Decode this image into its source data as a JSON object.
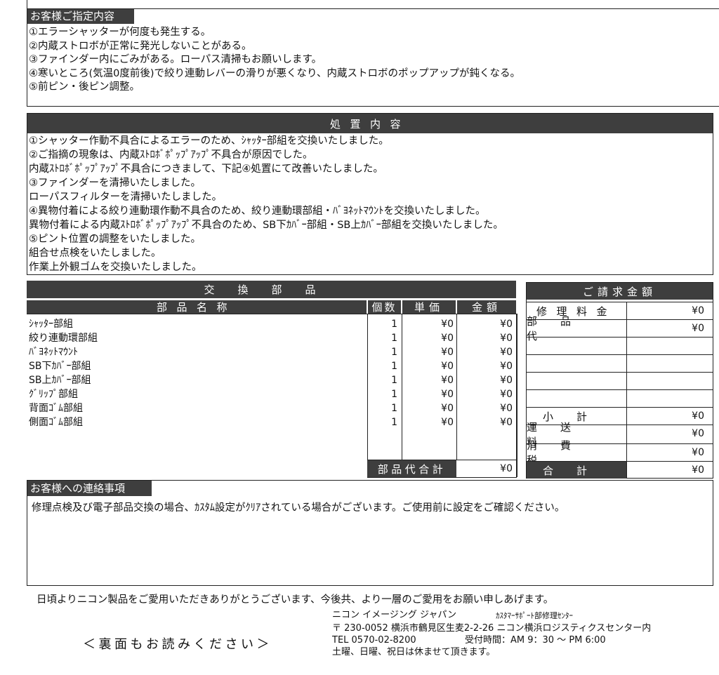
{
  "customer_request": {
    "title": "お客様ご指定内容",
    "lines": [
      "①エラーシャッターが何度も発生する。",
      "②内蔵ストロボが正常に発光しないことがある。",
      "③ファインダー内にごみがある。ローパス清掃もお願いします。",
      "④寒いところ(気温0度前後)で絞り連動レバーの滑りが悪くなり、内蔵ストロボのポップアップが鈍くなる。",
      "⑤前ピン・後ピン調整。"
    ]
  },
  "treatment": {
    "title": "処置内容",
    "lines": [
      "①シャッター作動不具合によるエラーのため、ｼｬｯﾀｰ部組を交換いたしました。",
      "②ご指摘の現象は、内蔵ｽﾄﾛﾎﾞﾎﾟｯﾌﾟｱｯﾌﾟ不具合が原因でした。",
      "内蔵ｽﾄﾛﾎﾞﾎﾟｯﾌﾟｱｯﾌﾟ不具合につきまして、下記④処置にて改善いたしました。",
      "③ファインダーを清掃いたしました。",
      "ローパスフィルターを清掃いたしました。",
      "④異物付着による絞り連動環作動不具合のため、絞り連動環部組・ﾊﾞﾖﾈｯﾄﾏｳﾝﾄを交換いたしました。",
      "異物付着による内蔵ｽﾄﾛﾎﾞﾎﾟｯﾌﾟｱｯﾌﾟ不具合のため、SB下ｶﾊﾞｰ部組・SB上ｶﾊﾞｰ部組を交換いたしました。",
      "⑤ピント位置の調整をいたしました。",
      "組合せ点検をいたしました。",
      "作業上外観ゴムを交換いたしました。"
    ]
  },
  "parts": {
    "title": "交換部品",
    "columns": [
      "部品名称",
      "個数",
      "単価",
      "金額"
    ],
    "rows": [
      {
        "name": "ｼｬｯﾀｰ部組",
        "qty": "1",
        "unit": "¥0",
        "amount": "¥0"
      },
      {
        "name": "絞り連動環部組",
        "qty": "1",
        "unit": "¥0",
        "amount": "¥0"
      },
      {
        "name": "ﾊﾞﾖﾈｯﾄﾏｳﾝﾄ",
        "qty": "1",
        "unit": "¥0",
        "amount": "¥0"
      },
      {
        "name": "SB下ｶﾊﾞｰ部組",
        "qty": "1",
        "unit": "¥0",
        "amount": "¥0"
      },
      {
        "name": "SB上ｶﾊﾞｰ部組",
        "qty": "1",
        "unit": "¥0",
        "amount": "¥0"
      },
      {
        "name": "ｸﾞﾘｯﾌﾟ部組",
        "qty": "1",
        "unit": "¥0",
        "amount": "¥0"
      },
      {
        "name": "背面ｺﾞﾑ部組",
        "qty": "1",
        "unit": "¥0",
        "amount": "¥0"
      },
      {
        "name": "側面ｺﾞﾑ部組",
        "qty": "1",
        "unit": "¥0",
        "amount": "¥0"
      }
    ],
    "total_label": "部品代合計",
    "total": "¥0"
  },
  "billing": {
    "title": "ご請求金額",
    "repair_fee_label": "修理料金",
    "repair_fee": "¥0",
    "parts_label": "部品代",
    "parts": "¥0",
    "subtotal_label": "小計",
    "subtotal": "¥0",
    "shipping_label": "運送料",
    "shipping": "¥0",
    "tax_label": "消費税",
    "tax": "¥0",
    "total_label": "合計",
    "total": "¥0"
  },
  "notice": {
    "title": "お客様への連絡事項",
    "text": "修理点検及び電子部品交換の場合、ｶｽﾀﾑ設定がｸﾘｱされている場合がございます。ご使用前に設定をご確認ください。"
  },
  "footer": {
    "thanks": "日頃よりニコン製品をご愛用いただきありがとうございます、今後共、より一層のご愛用をお願い申しあげます。",
    "read_back": "＜裏面もお読みください＞",
    "company": "ニコン イメージング ジャパン",
    "department": "ｶｽﾀﾏｰｻﾎﾟｰﾄ部修理ｾﾝﾀｰ",
    "address": "〒 230-0052  横浜市鶴見区生麦2-2-26  ニコン横浜ロジスティクスセンター内",
    "tel": "TEL 0570-02-8200",
    "hours": "受付時間：AM 9：30 ～ PM 6:00",
    "closed": "土曜、日曜、祝日は休ませて頂きます。"
  }
}
